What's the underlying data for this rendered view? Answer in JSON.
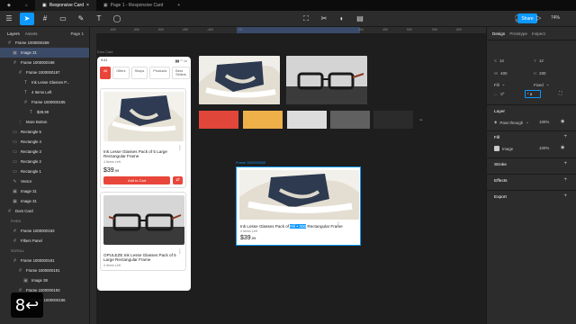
{
  "tabs": [
    {
      "label": "Responsive Card",
      "active": true
    },
    {
      "label": "Page 1 - Responsive Card",
      "active": false
    }
  ],
  "share_label": "Share",
  "zoom": "74%",
  "left_panel": {
    "tab_layers": "Layers",
    "tab_assets": "Assets",
    "page": "Page 1",
    "layers": [
      {
        "label": "Frame 1000000269",
        "indent": 0,
        "icon": "#",
        "selected": false
      },
      {
        "label": "Image 31",
        "indent": 1,
        "icon": "▣",
        "selected": true
      },
      {
        "label": "Frame 1000000198",
        "indent": 1,
        "icon": "#",
        "selected": false
      },
      {
        "label": "Frame 1000000197",
        "indent": 2,
        "icon": "#",
        "selected": false
      },
      {
        "label": "Ink Lesse Glasses P...",
        "indent": 3,
        "icon": "T",
        "selected": false
      },
      {
        "label": "4 Items Left",
        "indent": 3,
        "icon": "T",
        "selected": false
      },
      {
        "label": "Frame 1000000195",
        "indent": 3,
        "icon": "#",
        "selected": false
      },
      {
        "label": "$39,99",
        "indent": 4,
        "icon": "T",
        "selected": false
      },
      {
        "label": "More Button",
        "indent": 2,
        "icon": "⋮",
        "selected": false
      },
      {
        "label": "Rectangle 5",
        "indent": 1,
        "icon": "▭",
        "selected": false
      },
      {
        "label": "Rectangle 4",
        "indent": 1,
        "icon": "▭",
        "selected": false
      },
      {
        "label": "Rectangle 3",
        "indent": 1,
        "icon": "▭",
        "selected": false
      },
      {
        "label": "Rectangle 2",
        "indent": 1,
        "icon": "▭",
        "selected": false
      },
      {
        "label": "Rectangle 1",
        "indent": 1,
        "icon": "▭",
        "selected": false
      },
      {
        "label": "Vector",
        "indent": 1,
        "icon": "✎",
        "selected": false
      },
      {
        "label": "Image 31",
        "indent": 1,
        "icon": "▣",
        "selected": false
      },
      {
        "label": "Image 31",
        "indent": 1,
        "icon": "▣",
        "selected": false
      },
      {
        "label": "Dom Card",
        "indent": 0,
        "icon": "#",
        "selected": false
      },
      {
        "label": "Frame 1000000193",
        "indent": 1,
        "icon": "#",
        "selected": false
      },
      {
        "label": "Filters Panel",
        "indent": 1,
        "icon": "#",
        "selected": false
      },
      {
        "label": "Frame 1000000191",
        "indent": 1,
        "icon": "#",
        "selected": false
      },
      {
        "label": "Frame 1000000191",
        "indent": 2,
        "icon": "#",
        "selected": false
      },
      {
        "label": "Image 38",
        "indent": 3,
        "icon": "▣",
        "selected": false
      },
      {
        "label": "Frame 1000000193",
        "indent": 2,
        "icon": "#",
        "selected": false
      },
      {
        "label": "Frame 1000000196",
        "indent": 3,
        "icon": "#",
        "selected": false
      }
    ],
    "section_fixed": "FIXED",
    "section_scroll": "SCROLL"
  },
  "canvas": {
    "ruler_ticks": [
      "-600",
      "-550",
      "-500",
      "-450",
      "-400",
      "-350",
      "10",
      "150",
      "200",
      "250",
      "300",
      "350",
      "400",
      "450",
      "500",
      "550",
      "600",
      "650"
    ],
    "ruler_highlight": "10 — 195",
    "phone": {
      "label": "Dom Card",
      "time": "9:41",
      "chips": [
        "All",
        "Offers",
        "Shops",
        "Products",
        "Best Sellers"
      ],
      "card1_title": "Ink Lesse Glasses Pack of 5 Large Rectangular Frame",
      "card1_sub": "4 Items Left",
      "card1_price": "$39",
      "card1_cents": ",99",
      "add_to_cart": "Add to Cart",
      "card2_title": "OPULEZE Ink Lesse Glasses Pack of 5 Large Rectangular Frame",
      "card2_sub": "4 Items Left"
    },
    "frame_label": "Frame 1000000260",
    "swatch_colors": [
      "#e0463a",
      "#efb04a",
      "#dcdcdc",
      "#606060",
      "#2b2b2b"
    ],
    "desk_card": {
      "title_pre": "Ink Lesse Glasses Pack of ",
      "title_sel": "Fill • 300",
      "title_post": " Rectangular Frame",
      "sub": "4 Items Left",
      "price": "$39",
      "cents": ",99"
    }
  },
  "right_panel": {
    "tab_design": "Design",
    "tab_prototype": "Prototype",
    "tab_inspect": "Inspect",
    "x": "X",
    "x_val": "14",
    "y": "Y",
    "y_val": "12",
    "w": "W",
    "w_val": "400",
    "h": "H",
    "h_val": "200",
    "fill_label": "Fill",
    "fixed_label": "Fixed",
    "rotation": "0°",
    "radius_value": "8",
    "layer_title": "Layer",
    "pass_through": "Pass through",
    "layer_opacity": "100%",
    "fill_title": "Fill",
    "fill_item": "Image",
    "fill_opacity": "100%",
    "stroke_title": "Stroke",
    "effects_title": "Effects",
    "export_title": "Export"
  },
  "badge_text": "8↩"
}
